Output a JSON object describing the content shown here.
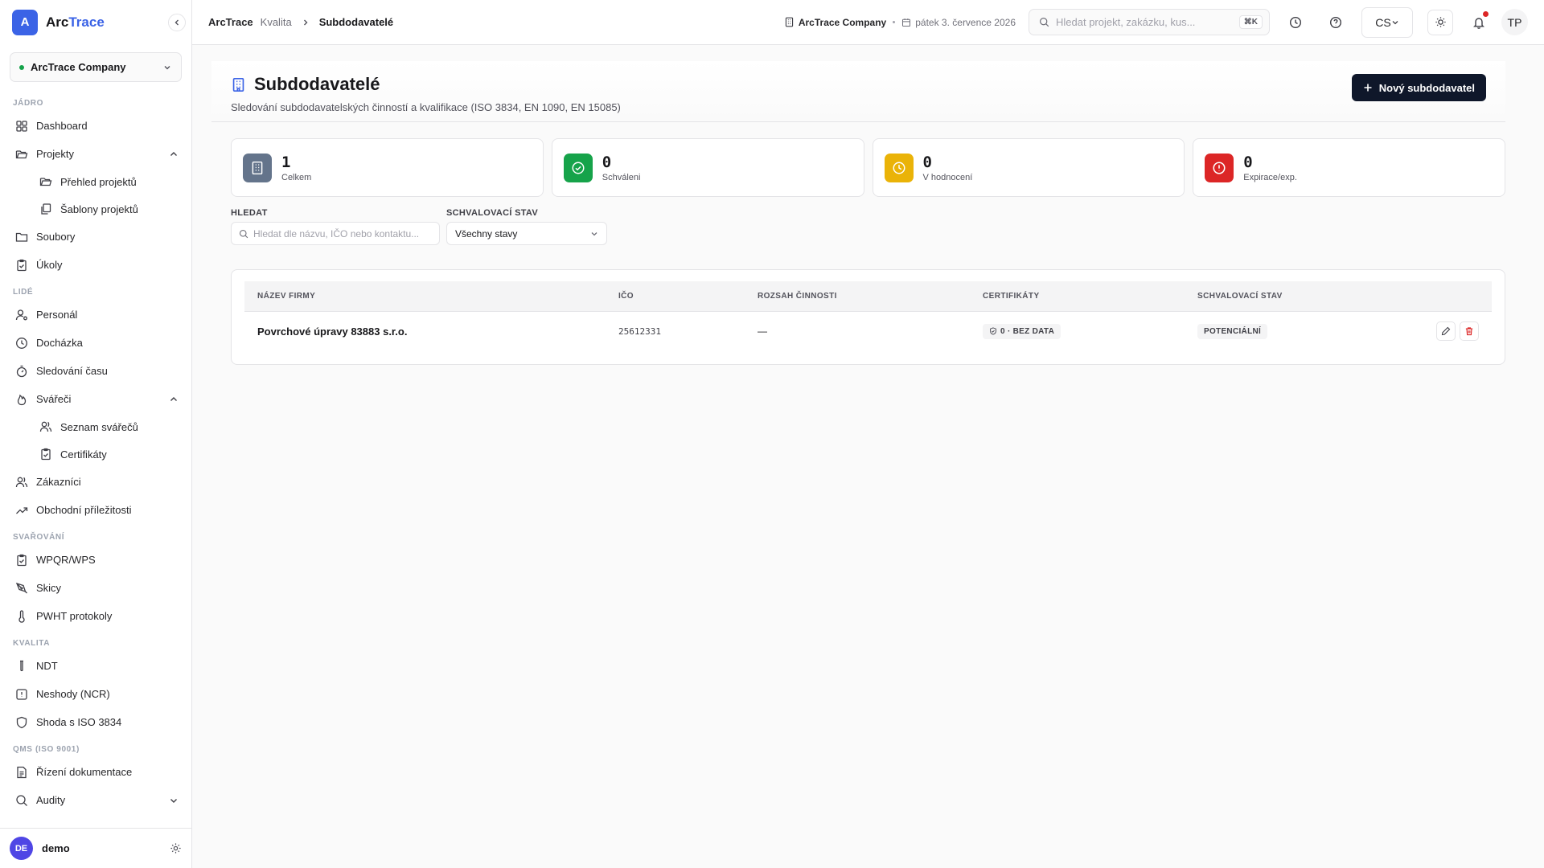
{
  "brand": {
    "logo_letter": "A",
    "name_a": "Arc",
    "name_b": "Trace"
  },
  "sidebar": {
    "company": "ArcTrace Company",
    "sections": {
      "jadro": "JÁDRO",
      "lide": "LIDÉ",
      "svarovani": "SVAŘOVÁNÍ",
      "kvalita": "KVALITA",
      "qms": "QMS (ISO 9001)"
    },
    "items": {
      "dashboard": "Dashboard",
      "projekty": "Projekty",
      "prehled": "Přehled projektů",
      "sablony": "Šablony projektů",
      "soubory": "Soubory",
      "ukoly": "Úkoly",
      "personal": "Personál",
      "dochazka": "Docházka",
      "sledovani": "Sledování času",
      "svareci": "Svářeči",
      "seznam": "Seznam svářečů",
      "certifikaty": "Certifikáty",
      "zakaznici": "Zákazníci",
      "obchodni": "Obchodní příležitosti",
      "wpqr": "WPQR/WPS",
      "skicy": "Skicy",
      "pwht": "PWHT protokoly",
      "ndt": "NDT",
      "neshody": "Neshody (NCR)",
      "shoda": "Shoda s ISO 3834",
      "rizeni": "Řízení dokumentace",
      "audity": "Audity"
    },
    "user": {
      "initials": "DE",
      "name": "demo"
    }
  },
  "topbar": {
    "crumb1": "ArcTrace",
    "crumb2": "Kvalita",
    "crumb3": "Subdodavatelé",
    "company": "ArcTrace Company",
    "date": "pátek 3. července 2026",
    "search_placeholder": "Hledat projekt, zakázku, kus...",
    "kbd": "⌘K",
    "lang": "CS",
    "avatar": "TP"
  },
  "page": {
    "title": "Subdodavatelé",
    "subtitle": "Sledování subdodavatelských činností a kvalifikace (ISO 3834, EN 1090, EN 15085)",
    "new_button": "Nový subdodavatel"
  },
  "stats": [
    {
      "value": "1",
      "label": "Celkem"
    },
    {
      "value": "0",
      "label": "Schváleni"
    },
    {
      "value": "0",
      "label": "V hodnocení"
    },
    {
      "value": "0",
      "label": "Expirace/exp."
    }
  ],
  "filters": {
    "search_label": "HLEDAT",
    "search_placeholder": "Hledat dle názvu, IČO nebo kontaktu...",
    "status_label": "SCHVALOVACÍ STAV",
    "status_value": "Všechny stavy"
  },
  "table": {
    "headers": [
      "NÁZEV FIRMY",
      "IČO",
      "ROZSAH ČINNOSTI",
      "CERTIFIKÁTY",
      "SCHVALOVACÍ STAV"
    ],
    "rows": [
      {
        "name": "Povrchové úpravy 83883 s.r.o.",
        "ico": "25612331",
        "scope": "—",
        "certs": "0 · BEZ DATA",
        "status": "POTENCIÁLNÍ"
      }
    ]
  },
  "colors": {
    "accent": "#3b63e6",
    "primary_button": "#0f172a",
    "stat_total": "#64748b",
    "stat_approved": "#16a34a",
    "stat_eval": "#eab308",
    "stat_exp": "#dc2626"
  }
}
